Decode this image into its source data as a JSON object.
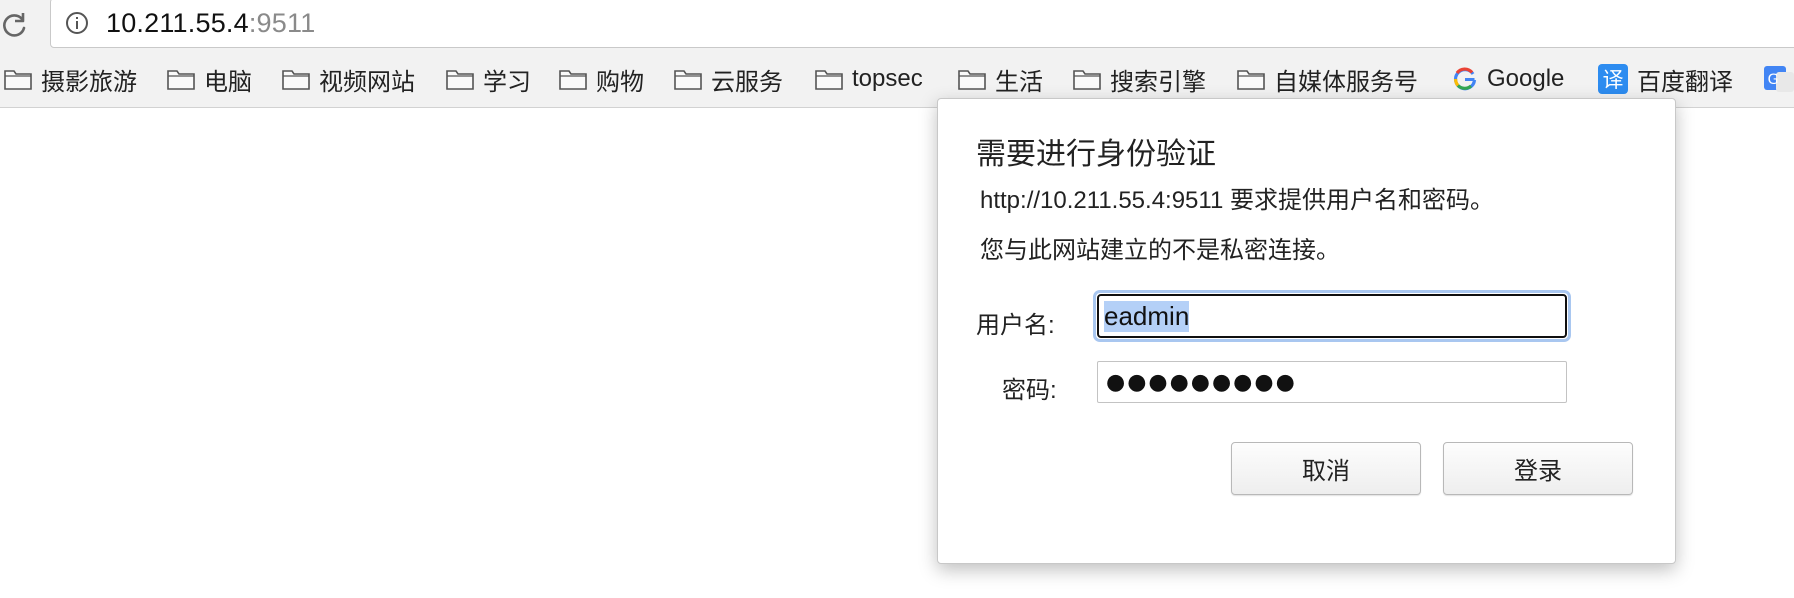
{
  "address_bar": {
    "host": "10.211.55.4",
    "port": ":9511"
  },
  "bookmarks": [
    {
      "label": "摄影旅游",
      "icon": "folder-icon"
    },
    {
      "label": "电脑",
      "icon": "folder-icon"
    },
    {
      "label": "视频网站",
      "icon": "folder-icon"
    },
    {
      "label": "学习",
      "icon": "folder-icon"
    },
    {
      "label": "购物",
      "icon": "folder-icon"
    },
    {
      "label": "云服务",
      "icon": "folder-icon"
    },
    {
      "label": "topsec",
      "icon": "folder-icon"
    },
    {
      "label": "生活",
      "icon": "folder-icon"
    },
    {
      "label": "搜索引擎",
      "icon": "folder-icon"
    },
    {
      "label": "自媒体服务号",
      "icon": "folder-icon"
    },
    {
      "label": "Google",
      "icon": "google-icon"
    },
    {
      "label": "百度翻译",
      "icon": "baidu-translate-icon",
      "icon_text": "译"
    }
  ],
  "dialog": {
    "title": "需要进行身份验证",
    "message": "http://10.211.55.4:9511 要求提供用户名和密码。",
    "privacy_note": "您与此网站建立的不是私密连接。",
    "username_label": "用户名:",
    "password_label": "密码:",
    "username_value": "eadmin",
    "password_value": "●●●●●●●●●",
    "cancel_label": "取消",
    "login_label": "登录"
  },
  "colors": {
    "focus_ring": "#a9c7f0",
    "toolbar_bg": "#f2f2f2",
    "baidu_blue": "#2d8cf0"
  }
}
